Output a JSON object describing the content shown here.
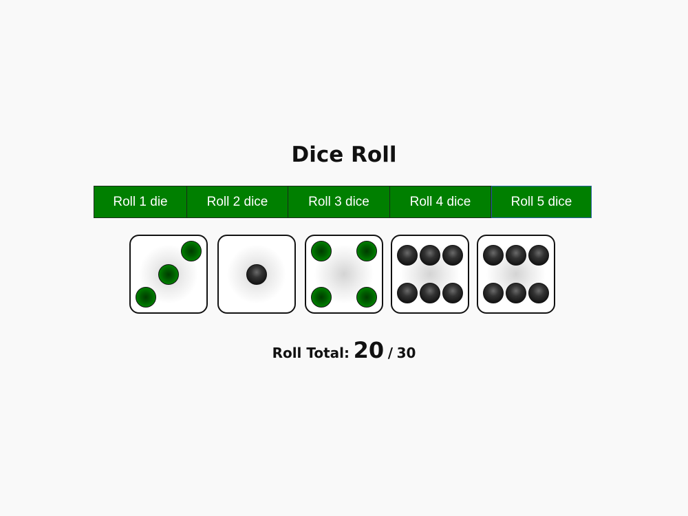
{
  "title": "Dice Roll",
  "buttons": [
    {
      "label": "Roll 1 die"
    },
    {
      "label": "Roll 2 dice"
    },
    {
      "label": "Roll 3 dice"
    },
    {
      "label": "Roll 4 dice"
    },
    {
      "label": "Roll 5 dice"
    }
  ],
  "selected_button": "Roll 5 dice",
  "dice": [
    {
      "value": 3,
      "pip_color": "#007f00"
    },
    {
      "value": 1,
      "pip_color": "#222222"
    },
    {
      "value": 4,
      "pip_color": "#007f00"
    },
    {
      "value": 6,
      "pip_color": "#222222"
    },
    {
      "value": 6,
      "pip_color": "#222222"
    }
  ],
  "total": {
    "label": "Roll Total:",
    "value": "20",
    "separator": "/",
    "max": "30"
  },
  "colors": {
    "button_bg": "#007f00",
    "button_text": "#ffffff",
    "page_bg": "#f9f9f9"
  }
}
